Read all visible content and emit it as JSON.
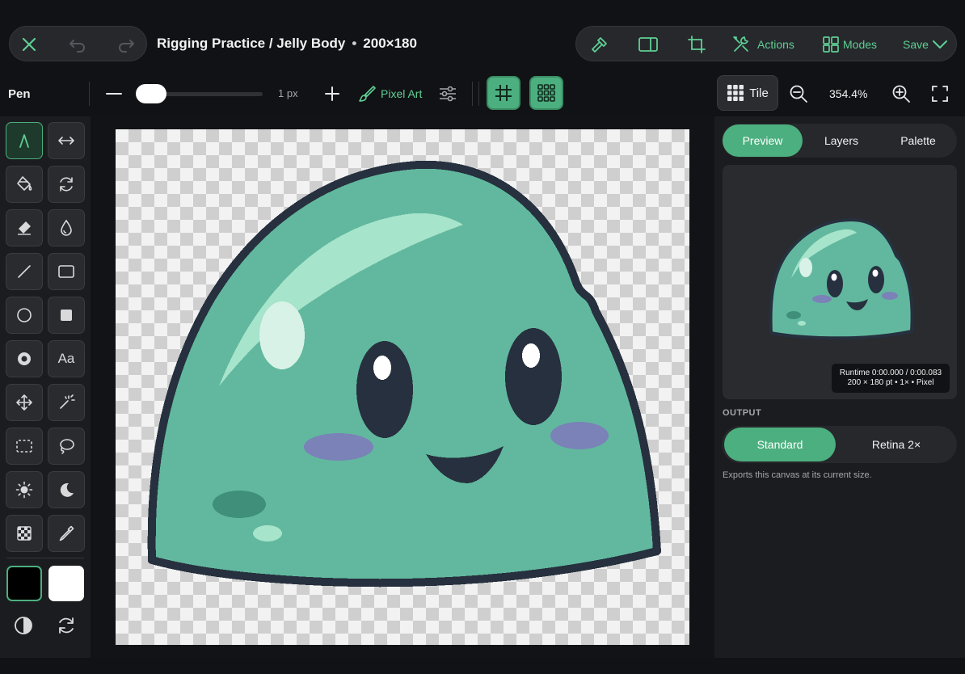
{
  "header": {
    "title": "Rigging Practice / Jelly Body",
    "separator": "•",
    "dimensions": "200×180",
    "actions_label": "Actions",
    "modes_label": "Modes",
    "save_label": "Save"
  },
  "options": {
    "tool_name": "Pen",
    "brush_size": "1 px",
    "brush_size_value": 1,
    "brush_mode": "Pixel Art"
  },
  "zoom": {
    "tile_label": "Tile",
    "level": "354.4%"
  },
  "tools": [
    "pen-icon",
    "flip-horizontal-icon",
    "paint-bucket-icon",
    "rotate-icon",
    "eraser-icon",
    "smudge-drop-icon",
    "line-icon",
    "rectangle-outline-icon",
    "ellipse-outline-icon",
    "rectangle-filled-icon",
    "ellipse-filled-icon",
    "text-icon",
    "move-icon",
    "magic-wand-icon",
    "rect-select-icon",
    "lasso-icon",
    "brighten-icon",
    "darken-icon",
    "dither-icon",
    "eyedropper-icon"
  ],
  "text_tool_label": "Aa",
  "colors": {
    "primary": "#000000",
    "secondary": "#ffffff",
    "accent": "#4caf7f",
    "slime_body": "#62b89e",
    "slime_outline": "#26303e",
    "blush": "#7a82b8"
  },
  "panel": {
    "tabs": [
      "Preview",
      "Layers",
      "Palette"
    ],
    "active_tab": "Preview",
    "runtime_line1": "Runtime 0:00.000 / 0:00.083",
    "runtime_line2": "200 × 180 pt • 1× • Pixel",
    "output_label": "OUTPUT",
    "output_options": [
      "Standard",
      "Retina 2×"
    ],
    "active_output": "Standard",
    "output_note": "Exports this canvas at its current size."
  }
}
